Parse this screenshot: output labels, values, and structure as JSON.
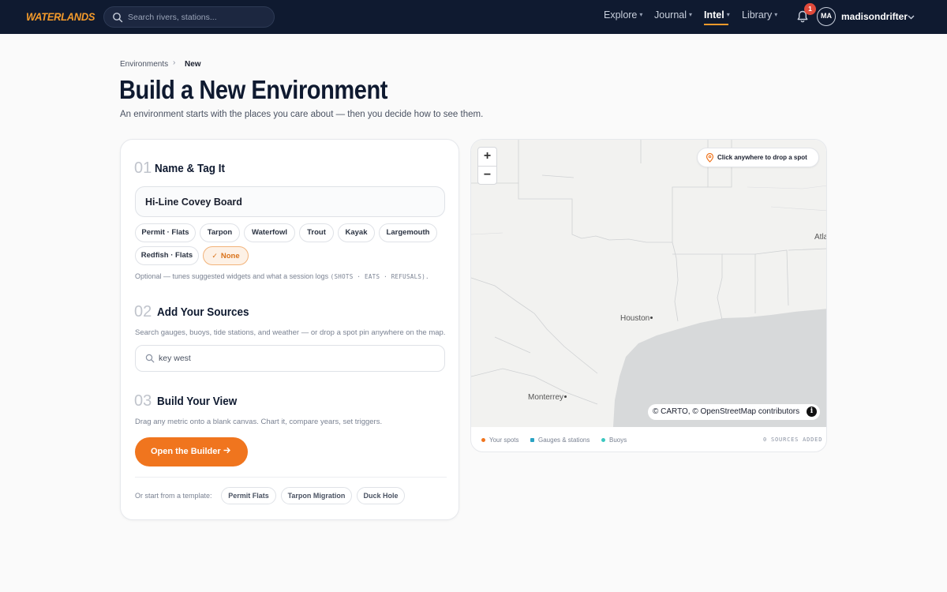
{
  "topbar": {
    "logo": "WATERLANDS",
    "search_placeholder": "Search rivers, stations...",
    "nav": [
      {
        "label": "Explore",
        "active": false
      },
      {
        "label": "Journal",
        "active": false
      },
      {
        "label": "Intel",
        "active": true
      },
      {
        "label": "Library",
        "active": false
      }
    ],
    "notification_count": "1",
    "avatar_initials": "MA",
    "username": "madisondrifter",
    "accent_color": "#f39a2b"
  },
  "breadcrumb": {
    "parent": "Environments",
    "separator": "›",
    "current": "New"
  },
  "page": {
    "title": "Build a New Environment",
    "subtitle": "An environment starts with the places you care about — then you decide how to see them."
  },
  "step1": {
    "number": "01",
    "title": "Name & Tag It",
    "name_value": "Hi-Line Covey Board",
    "tags": [
      "Permit · Flats",
      "Tarpon",
      "Waterfowl",
      "Trout",
      "Kayak",
      "Largemouth",
      "Redfish · Flats"
    ],
    "selected_tag": "None",
    "hint_text": "Optional — tunes suggested widgets and what a session logs",
    "hint_mono": "(SHOTS · EATS · REFUSALS)."
  },
  "step2": {
    "number": "02",
    "title": "Add Your Sources",
    "hint": "Search gauges, buoys, tide stations, and weather — or drop a spot pin anywhere on the map.",
    "search_value": "key west"
  },
  "step3": {
    "number": "03",
    "title": "Build Your View",
    "hint": "Drag any metric onto a blank canvas. Chart it, compare years, set triggers.",
    "button_label": "Open the Builder",
    "button_color": "#f0751e"
  },
  "templates": {
    "label": "Or start from a template:",
    "items": [
      "Permit Flats",
      "Tarpon Migration",
      "Duck Hole"
    ]
  },
  "map": {
    "zoom_in": "+",
    "zoom_out": "−",
    "drop_hint": "Click anywhere to drop a spot",
    "cities": {
      "houston": "Houston",
      "monterrey": "Monterrey",
      "atlanta_partial": "Atla"
    },
    "attribution": "© CARTO, © OpenStreetMap contributors",
    "info": "i",
    "legend": [
      {
        "label": "Your spots",
        "color": "#f0751e"
      },
      {
        "label": "Gauges & stations",
        "color": "#2aa3c4"
      },
      {
        "label": "Buoys",
        "color": "#3cc7c0"
      }
    ],
    "sources_added": "0 SOURCES ADDED"
  }
}
